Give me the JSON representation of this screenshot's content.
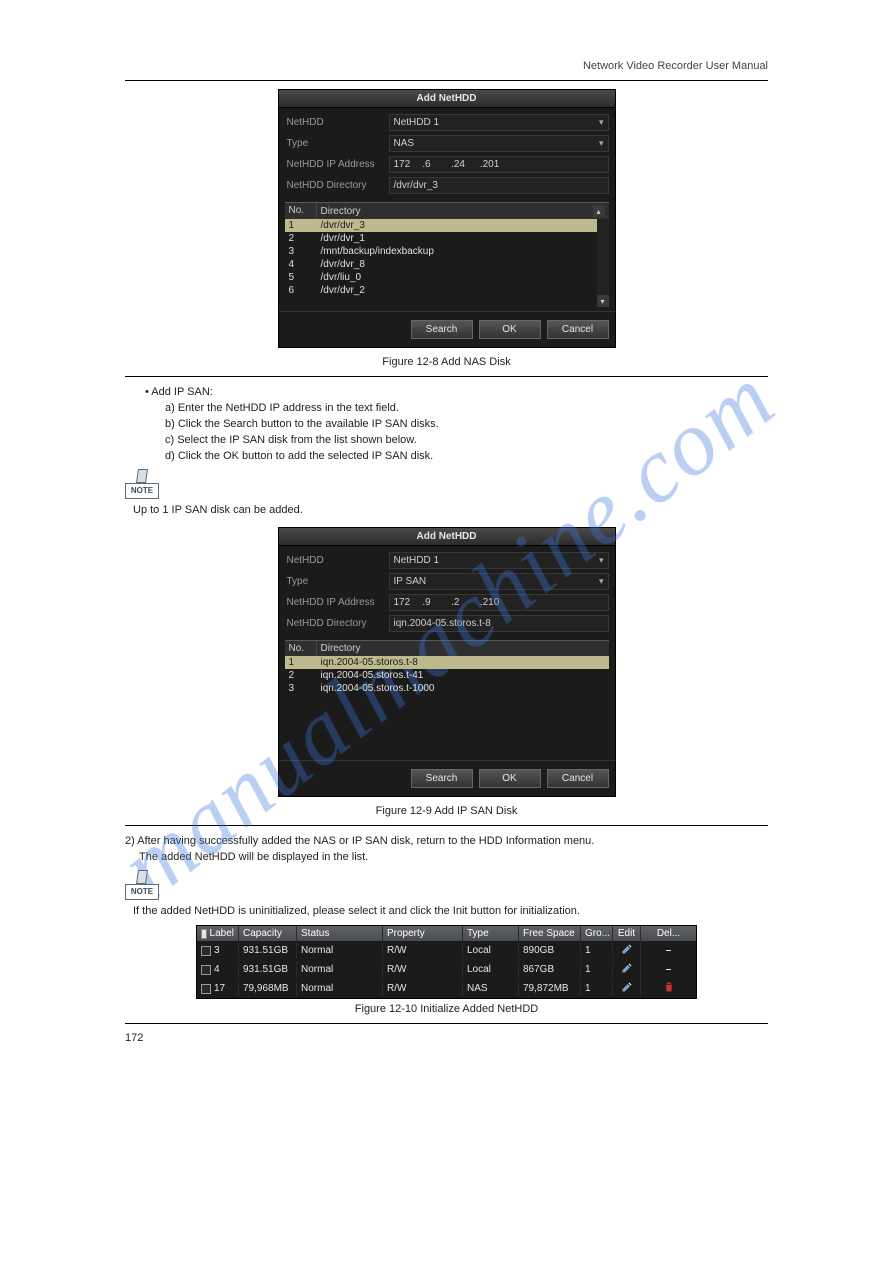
{
  "header_text": "Network Video Recorder User Manual",
  "dialog1": {
    "title": "Add NetHDD",
    "fields": {
      "nethdd_label": "NetHDD",
      "nethdd_value": "NetHDD 1",
      "type_label": "Type",
      "type_value": "NAS",
      "ip_label": "NetHDD IP Address",
      "ip_value_1": "172",
      "ip_value_2": ".6",
      "ip_value_3": ".24",
      "ip_value_4": ".201",
      "dir_label": "NetHDD Directory",
      "dir_value": "/dvr/dvr_3"
    },
    "table": {
      "head_no": "No.",
      "head_dir": "Directory",
      "rows": [
        {
          "no": "1",
          "dir": "/dvr/dvr_3",
          "active": true
        },
        {
          "no": "2",
          "dir": "/dvr/dvr_1",
          "active": false
        },
        {
          "no": "3",
          "dir": "/mnt/backup/indexbackup",
          "active": false
        },
        {
          "no": "4",
          "dir": "/dvr/dvr_8",
          "active": false
        },
        {
          "no": "5",
          "dir": "/dvr/liu_0",
          "active": false
        },
        {
          "no": "6",
          "dir": "/dvr/dvr_2",
          "active": false
        }
      ]
    },
    "buttons": {
      "search": "Search",
      "ok": "OK",
      "cancel": "Cancel"
    }
  },
  "caption1": "Figure 12-8 Add NAS Disk",
  "instr_block": {
    "bullet_title": "• Add IP SAN:",
    "a": "a) Enter the NetHDD IP address in the text field.",
    "b": "b) Click the Search button to the available IP SAN disks.",
    "c": "c) Select the IP SAN disk from the list shown below.",
    "d": "d) Click the OK button to add the selected IP SAN disk."
  },
  "note_icon_text": "NOTE",
  "note1": "Up to 1 IP SAN disk can be added.",
  "dialog2": {
    "title": "Add NetHDD",
    "fields": {
      "nethdd_label": "NetHDD",
      "nethdd_value": "NetHDD 1",
      "type_label": "Type",
      "type_value": "IP SAN",
      "ip_label": "NetHDD IP Address",
      "ip_value_1": "172",
      "ip_value_2": ".9",
      "ip_value_3": ".2",
      "ip_value_4": ".210",
      "dir_label": "NetHDD Directory",
      "dir_value": "iqn.2004-05.storos.t-8"
    },
    "table": {
      "head_no": "No.",
      "head_dir": "Directory",
      "rows": [
        {
          "no": "1",
          "dir": "iqn.2004-05.storos.t-8",
          "active": true
        },
        {
          "no": "2",
          "dir": "iqn.2004-05.storos.t-41",
          "active": false
        },
        {
          "no": "3",
          "dir": "iqn.2004-05.storos.t-1000",
          "active": false
        }
      ]
    },
    "buttons": {
      "search": "Search",
      "ok": "OK",
      "cancel": "Cancel"
    }
  },
  "caption2": "Figure 12-9 Add IP SAN Disk",
  "step2_line1": "2) After having successfully added the NAS or IP SAN disk, return to the HDD Information menu.",
  "step2_line2": "The added NetHDD will be displayed in the list.",
  "note2": "If the added NetHDD is uninitialized, please select it and click the Init button for initialization.",
  "hdd_table": {
    "headers": {
      "label": "Label",
      "capacity": "Capacity",
      "status": "Status",
      "property": "Property",
      "type": "Type",
      "freespace": "Free Space",
      "group": "Gro...",
      "edit": "Edit",
      "del": "Del..."
    },
    "rows": [
      {
        "label": "3",
        "capacity": "931.51GB",
        "status": "Normal",
        "property": "R/W",
        "type": "Local",
        "freespace": "890GB",
        "group": "1",
        "del": "dash"
      },
      {
        "label": "4",
        "capacity": "931.51GB",
        "status": "Normal",
        "property": "R/W",
        "type": "Local",
        "freespace": "867GB",
        "group": "1",
        "del": "dash"
      },
      {
        "label": "17",
        "capacity": "79,968MB",
        "status": "Normal",
        "property": "R/W",
        "type": "NAS",
        "freespace": "79,872MB",
        "group": "1",
        "del": "trash"
      }
    ]
  },
  "caption3": "Figure 12-10 Initialize Added NetHDD",
  "page_number": "172",
  "watermark": "manualmachine.com"
}
